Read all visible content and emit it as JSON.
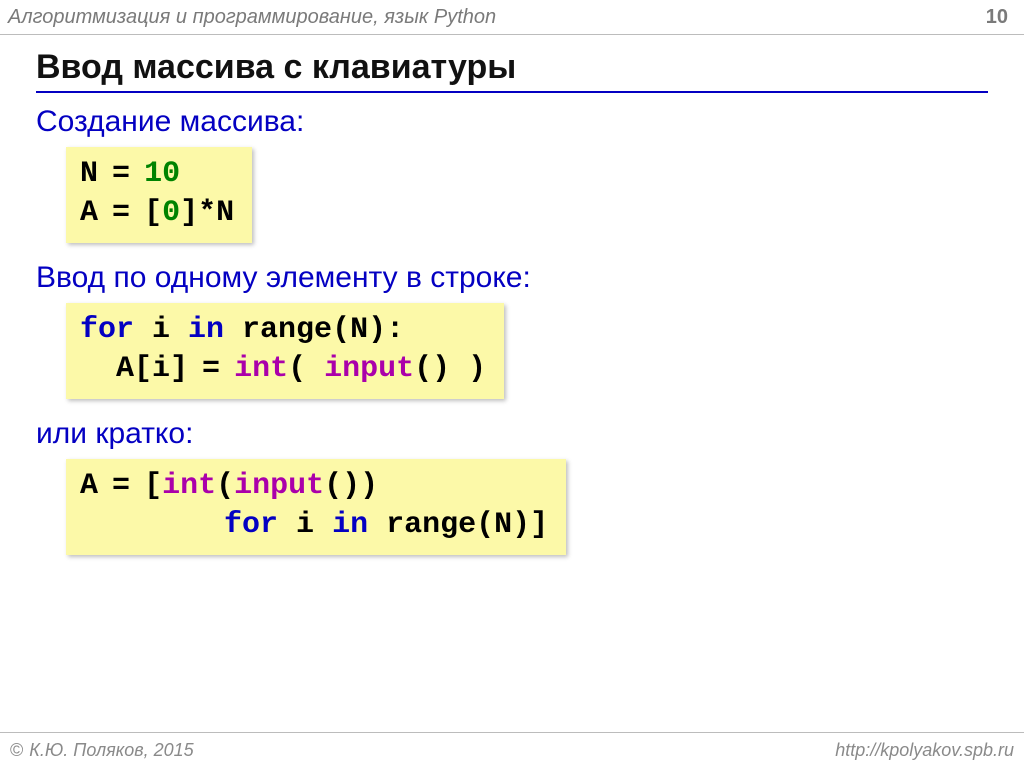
{
  "header": {
    "title": "Алгоритмизация и программирование, язык Python",
    "page": "10"
  },
  "heading": "Ввод массива с клавиатуры",
  "sections": {
    "s1": "Создание массива:",
    "s2": "Ввод по одному элементу в строке:",
    "s3": "или кратко:"
  },
  "code1": {
    "t1": "N",
    "eq1": "=",
    "v1": "10",
    "t2": "A",
    "eq2": "=",
    "t3": "[",
    "v2": "0",
    "t4": "]*N"
  },
  "code2": {
    "kw_for": "for",
    "t1": " i ",
    "kw_in": "in",
    "t2": " range(N):",
    "indent": "  A[i]",
    "eq": "=",
    "fn_int": "int",
    "t3": "( ",
    "fn_input": "input",
    "t4": "() )"
  },
  "code3": {
    "t1": "A",
    "eq": "=",
    "t2": "[",
    "fn_int": "int",
    "t3": "(",
    "fn_input": "input",
    "t4": "())",
    "indent": "        ",
    "kw_for": "for",
    "t5": " i ",
    "kw_in": "in",
    "t6": " range(N)]"
  },
  "footer": {
    "copyright_symbol": "©",
    "copyright": " К.Ю. Поляков, 2015",
    "url": "http://kpolyakov.spb.ru"
  }
}
